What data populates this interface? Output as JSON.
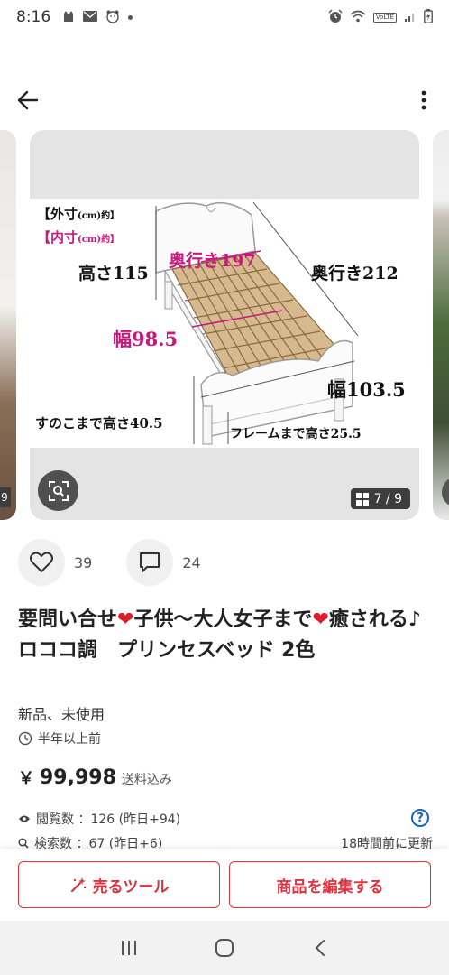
{
  "status_bar": {
    "time": "8:16",
    "icons": [
      "cat-notification-icon",
      "mail-icon",
      "bear-icon",
      "dot-icon",
      "alarm-icon",
      "wifi-icon",
      "volte-icon",
      "signal-icon",
      "battery-icon"
    ],
    "volte_label": "VoLTE"
  },
  "app_bar": {
    "back_icon": "arrow-left-icon",
    "more_icon": "more-vertical-icon"
  },
  "image": {
    "counter": "7 / 9",
    "labels": {
      "outer_size": "【外寸",
      "outer_unit": "(cm)約】",
      "inner_size": "【内寸",
      "inner_unit": "(cm)約】",
      "height": "高さ115",
      "inner_depth": "奥行き197",
      "outer_depth": "奥行き212",
      "inner_width": "幅98.5",
      "outer_width": "幅103.5",
      "slat_height": "すのこまで高さ40.5",
      "frame_height": "フレームまで高さ25.5"
    },
    "colors": {
      "pink": "#c8187e",
      "slats": "#d6b98e"
    }
  },
  "actions": {
    "likes": "39",
    "comments": "24"
  },
  "product": {
    "title_part1": "要問い合せ",
    "title_part2": "子供～大人女子まで",
    "title_part3": "癒される♪ロココ調　プリンセスベッド 2色",
    "heart_glyph": "❤",
    "condition": "新品、未使用",
    "listed_time": "半年以上前",
    "price_yen": "￥",
    "price": "99,998",
    "shipping": "送料込み",
    "views": "閲覧数 ：126 (昨日+94)",
    "searches": "検索数 ：67 (昨日+6)",
    "updated": "18時間前に更新"
  },
  "bottom_bar": {
    "sell_tool": "売るツール",
    "edit_item": "商品を編集する",
    "accent": "#e0323e"
  }
}
